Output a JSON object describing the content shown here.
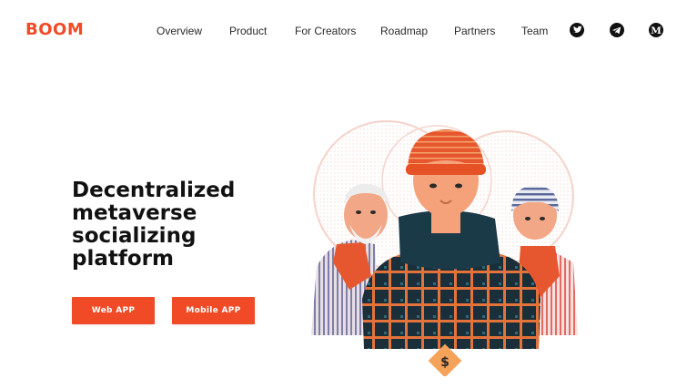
{
  "brand": {
    "logo_text": "BOOM",
    "accent_color": "#f04a26"
  },
  "nav": {
    "links": [
      {
        "label": "Overview"
      },
      {
        "label": "Product"
      },
      {
        "label": "For Creators"
      },
      {
        "label": "Roadmap"
      },
      {
        "label": "Partners"
      },
      {
        "label": "Team"
      }
    ],
    "social": [
      {
        "icon": "twitter-icon"
      },
      {
        "icon": "telegram-icon"
      },
      {
        "icon": "medium-icon",
        "glyph": "M"
      }
    ]
  },
  "hero": {
    "headline_lines": [
      "Decentralized",
      "metaverse",
      "socializing",
      "platform"
    ],
    "buttons": {
      "web_app": "Web APP",
      "mobile_app": "Mobile APP"
    },
    "illustration": {
      "coin_symbol": "$"
    }
  }
}
